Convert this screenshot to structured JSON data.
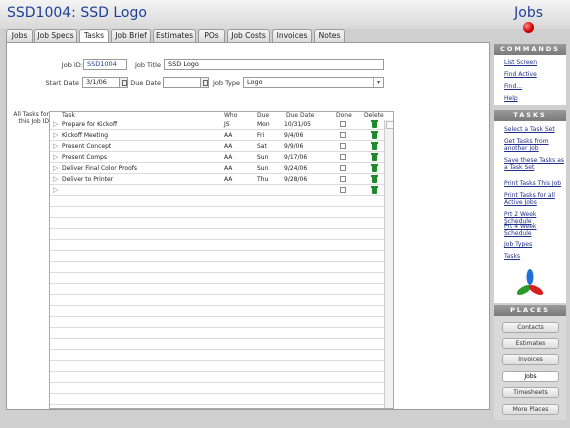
{
  "header": {
    "title": "SSD1004: SSD Logo",
    "module": "Jobs"
  },
  "tabs": [
    "Jobs",
    "Job Specs",
    "Tasks",
    "Job Brief",
    "Estimates",
    "POs",
    "Job Costs",
    "Invoices",
    "Notes"
  ],
  "active_tab": "Tasks",
  "form": {
    "job_id_label": "Job ID:",
    "job_id": "SSD1004",
    "job_title_label": "Job Title",
    "job_title": "SSD Logo",
    "start_date_label": "Start Date",
    "start_date": "3/1/06",
    "due_date_label": "Due Date",
    "due_date": "",
    "job_type_label": "Job Type",
    "job_type": "Logo"
  },
  "tasks_side_label": "All Tasks for this Job ID",
  "table": {
    "headers": {
      "task": "Task",
      "who": "Who",
      "due": "Due",
      "due_date": "Due Date",
      "done": "Done",
      "delete": "Delete"
    },
    "rows": [
      {
        "task": "Prepare for Kickoff",
        "who": "JS",
        "due": "Mon",
        "due_date": "10/31/05"
      },
      {
        "task": "Kickoff Meeting",
        "who": "AA",
        "due": "Fri",
        "due_date": "9/4/06"
      },
      {
        "task": "Present Concept",
        "who": "AA",
        "due": "Sat",
        "due_date": "9/9/06"
      },
      {
        "task": "Present Comps",
        "who": "AA",
        "due": "Sun",
        "due_date": "9/17/06"
      },
      {
        "task": "Deliver Final Color Proofs",
        "who": "AA",
        "due": "Sun",
        "due_date": "9/24/06"
      },
      {
        "task": "Deliver to Printer",
        "who": "AA",
        "due": "Thu",
        "due_date": "9/28/06"
      }
    ]
  },
  "sidebar": {
    "commands_head": "COMMANDS",
    "commands": [
      "List Screen",
      "Find Active",
      "Find...",
      "Help"
    ],
    "tasks_head": "TASKS",
    "tasks": [
      "Select a Task Set",
      "Get Tasks from another Job",
      "Save these Tasks as a Task Set",
      "Print Tasks This Job",
      "Print Tasks for all Active Jobs",
      "Prt 2 Week Schedule",
      "Prt 4 Week Schedule",
      "Job Types",
      "Tasks"
    ],
    "places_head": "PLACES",
    "places": [
      "Contacts",
      "Estimates",
      "Invoices",
      "Jobs",
      "Timesheets",
      "More Places"
    ],
    "active_place": "Jobs"
  }
}
